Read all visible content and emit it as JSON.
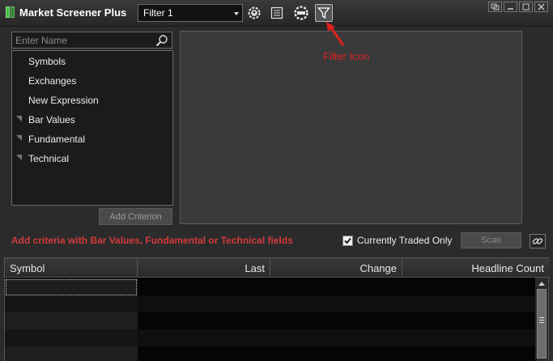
{
  "app": {
    "title": "Market Screener Plus"
  },
  "toolbar": {
    "filter_value": "Filter 1"
  },
  "search": {
    "placeholder": "Enter Name"
  },
  "criteria": {
    "items": [
      {
        "label": "Symbols",
        "expandable": false
      },
      {
        "label": "Exchanges",
        "expandable": false
      },
      {
        "label": "New Expression",
        "expandable": false
      },
      {
        "label": "Bar Values",
        "expandable": true
      },
      {
        "label": "Fundamental",
        "expandable": true
      },
      {
        "label": "Technical",
        "expandable": true
      }
    ],
    "add_label": "Add Criterion"
  },
  "annotation": {
    "text": "Filter Icon",
    "color": "#e02020"
  },
  "hint": {
    "text": "Add criteria with Bar Values, Fundamental or Technical fields",
    "color": "#d43a3a"
  },
  "options": {
    "currently_traded_label": "Currently Traded Only",
    "currently_traded_checked": true,
    "scan_label": "Scan"
  },
  "results": {
    "columns": [
      "Symbol",
      "Last",
      "Change",
      "Headline Count"
    ]
  }
}
